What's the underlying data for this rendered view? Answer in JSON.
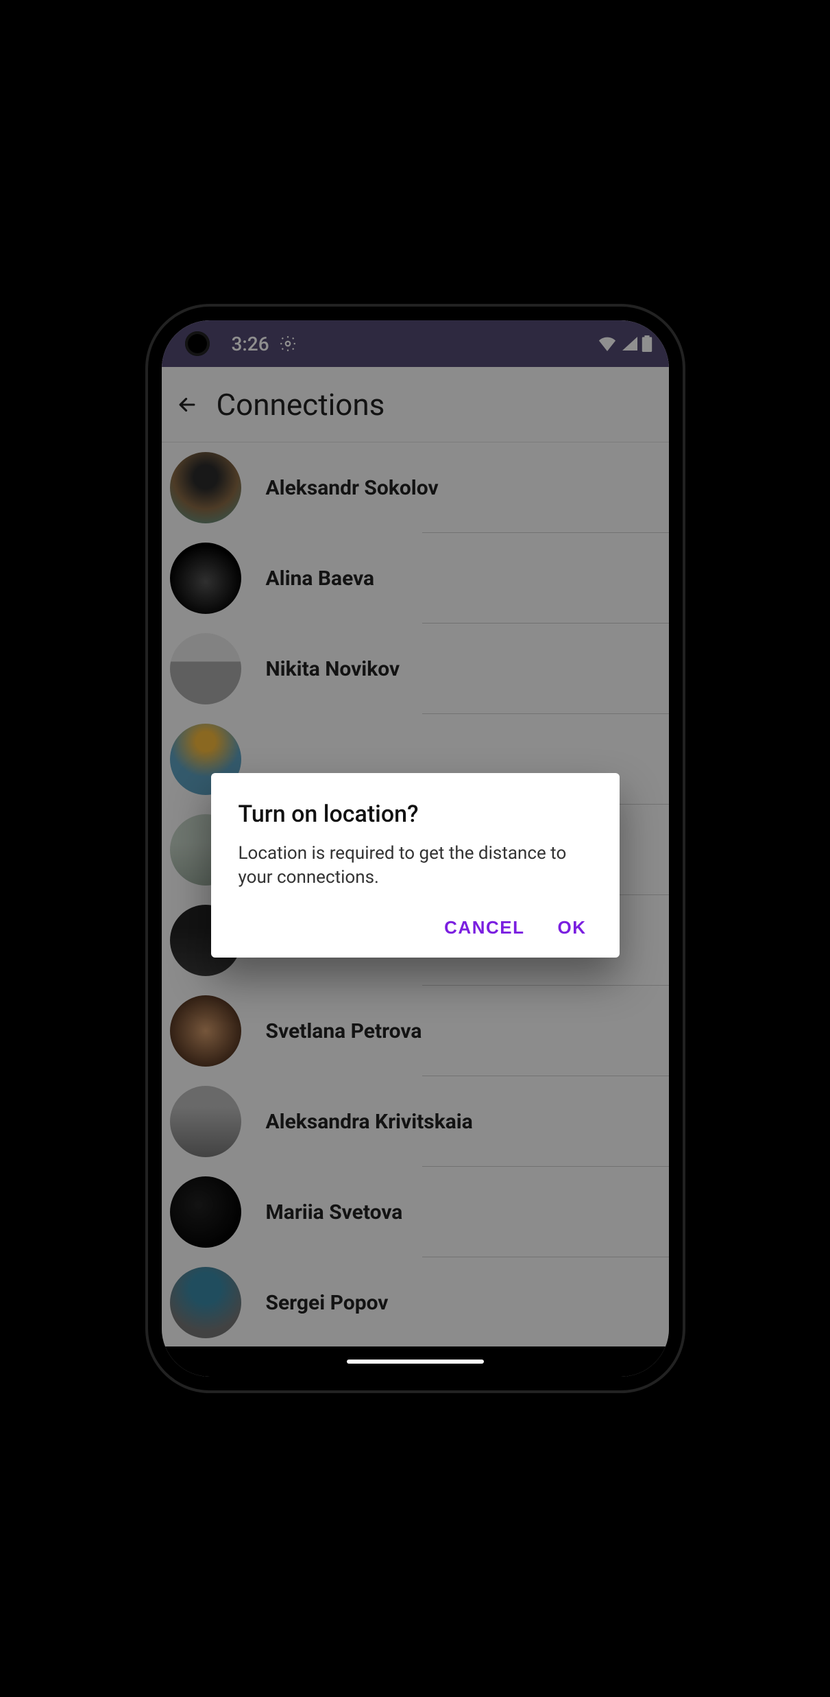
{
  "status": {
    "time": "3:26"
  },
  "appbar": {
    "title": "Connections"
  },
  "connections": [
    {
      "name": "Aleksandr Sokolov"
    },
    {
      "name": "Alina Baeva"
    },
    {
      "name": "Nikita Novikov"
    },
    {
      "name": ""
    },
    {
      "name": ""
    },
    {
      "name": ""
    },
    {
      "name": "Svetlana Petrova"
    },
    {
      "name": "Aleksandra Krivitskaia"
    },
    {
      "name": "Mariia Svetova"
    },
    {
      "name": "Sergei Popov"
    }
  ],
  "dialog": {
    "title": "Turn on location?",
    "body": "Location is required to get the distance to your connections.",
    "cancel": "CANCEL",
    "ok": "OK"
  },
  "colors": {
    "status_bar": "#534a73",
    "accent": "#7b1fe0"
  }
}
